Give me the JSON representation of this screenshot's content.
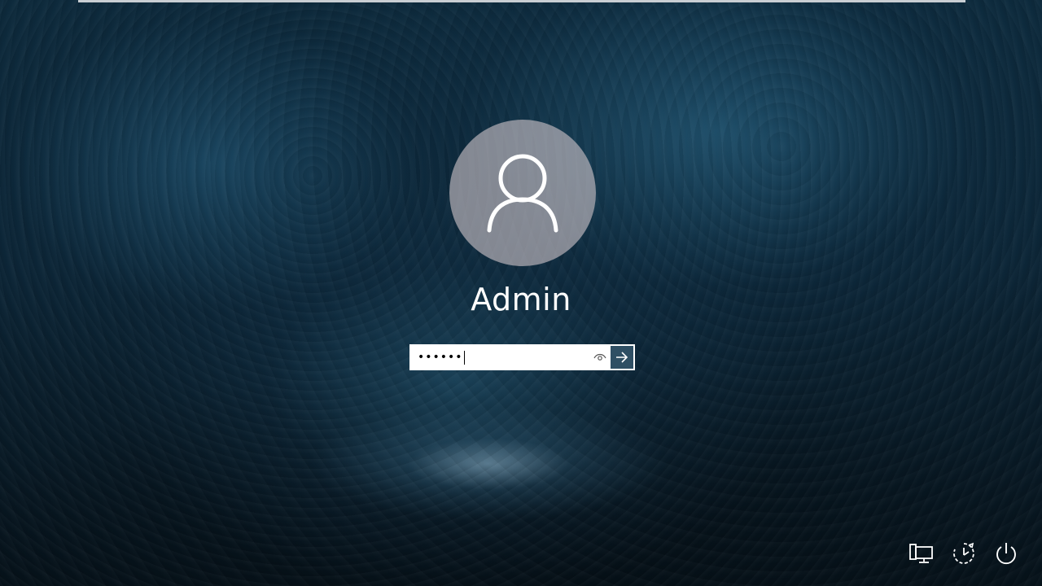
{
  "user": {
    "name": "Admin"
  },
  "password_field": {
    "masked_value": "••••••"
  },
  "icons": {
    "avatar": "user-icon",
    "reveal": "eye-icon",
    "submit": "arrow-right-icon",
    "network": "network-icon",
    "ease_of_access": "ease-of-access-icon",
    "power": "power-icon"
  },
  "colors": {
    "submit_button": "#2f4f64",
    "text": "#ffffff"
  }
}
